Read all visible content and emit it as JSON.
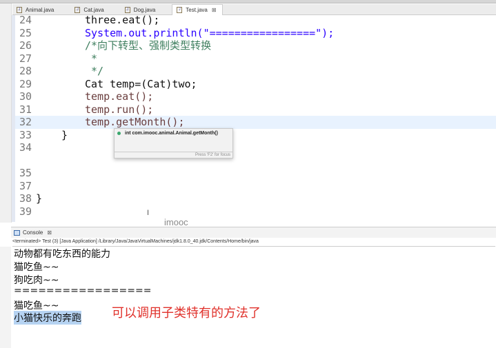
{
  "tabs": [
    {
      "label": "Animal.java"
    },
    {
      "label": "Cat.java"
    },
    {
      "label": "Dog.java"
    },
    {
      "label": "Test.java",
      "active": true,
      "close": "⊠"
    }
  ],
  "code_lines": [
    {
      "n": "24",
      "text": "three.eat();"
    },
    {
      "n": "25",
      "text": "System.out.println(\"=================\");"
    },
    {
      "n": "26",
      "text": "/*向下转型、强制类型转换"
    },
    {
      "n": "27",
      "text": " *"
    },
    {
      "n": "28",
      "text": " */"
    },
    {
      "n": "29",
      "text": "Cat temp=(Cat)two;"
    },
    {
      "n": "30",
      "text": "temp.eat();"
    },
    {
      "n": "31",
      "text": "temp.run();"
    },
    {
      "n": "32",
      "text": "temp.getMonth();"
    },
    {
      "n": "33",
      "text": "}"
    },
    {
      "n": "34",
      "text": ""
    },
    {
      "n": "35",
      "text": ""
    },
    {
      "n": "37",
      "text": ""
    },
    {
      "n": "38",
      "text": "}"
    },
    {
      "n": "39",
      "text": ""
    }
  ],
  "popup": {
    "item": "int com.imooc.animal.Animal.getMonth()",
    "footer": "Press 'F2' for focus"
  },
  "cursor": "I",
  "watermark": "imooc",
  "console": {
    "title": "Console",
    "close": "⊠",
    "status": "<terminated> Test (3) [Java Application] /Library/Java/JavaVirtualMachines/jdk1.8.0_40.jdk/Contents/Home/bin/java",
    "lines": [
      "动物都有吃东西的能力",
      "猫吃鱼~~",
      "狗吃肉~~",
      "=================",
      "猫吃鱼~~",
      "小猫快乐的奔跑"
    ]
  },
  "annotation": "可以调用子类特有的方法了"
}
